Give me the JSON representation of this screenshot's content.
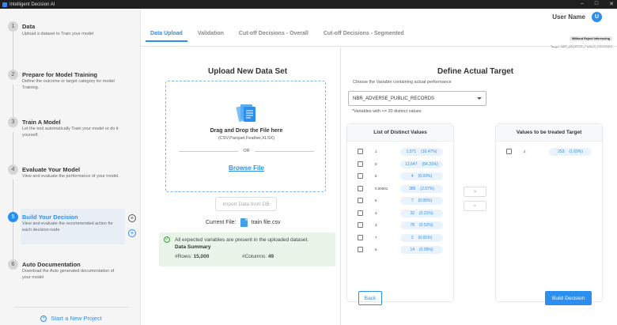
{
  "window": {
    "title": "Intelligent Decision AI"
  },
  "header": {
    "user_name": "User Name",
    "avatar_letter": "U"
  },
  "badge": {
    "label": "Without Reject Inferencing",
    "target": "Target: NBR_ADVERSE_PUBLIC_RECORDS"
  },
  "tabs": [
    {
      "label": "Data Upload",
      "active": true
    },
    {
      "label": "Validation",
      "active": false
    },
    {
      "label": "Cut-off Decisions - Overall",
      "active": false
    },
    {
      "label": "Cut-off Decisions - Segmented",
      "active": false
    }
  ],
  "steps": [
    {
      "num": "1",
      "title": "Data",
      "desc": "Upload a dataset to Train your model"
    },
    {
      "num": "2",
      "title": "Prepare for Model Training",
      "desc": "Define the outcome or target category for model Training."
    },
    {
      "num": "3",
      "title": "Train A Model",
      "desc": "Let the tool automatically Train your model or do it yourself."
    },
    {
      "num": "4",
      "title": "Evaluate Your Model",
      "desc": "View and evaluate the performance of your model."
    },
    {
      "num": "5",
      "title": "Build Your Decision",
      "desc": "View and evaluate the recommended action for each decision node"
    },
    {
      "num": "6",
      "title": "Auto Documentation",
      "desc": "Download the Auto generated documentation of your model"
    }
  ],
  "sidebar": {
    "new_project": "Start a New Project"
  },
  "upload": {
    "title": "Upload New Data Set",
    "drag_text": "Drag and Drop the File here",
    "types": "(CSV,Parquet,Feather,XLSX)",
    "or": "OR",
    "browse": "Browse File",
    "import": "Import Data from DB",
    "current_label": "Current File:",
    "current_file": "train file.csv"
  },
  "summary": {
    "message": "All expected variables are present in the uploaded dataset.",
    "title": "Data Summary",
    "rows_label": "#Rows:",
    "rows": "15,000",
    "cols_label": "#Columns:",
    "cols": "49"
  },
  "target": {
    "title": "Define Actual Target",
    "select_label": "Choose the Variable containing actual performance",
    "select_value": "NBR_ADVERSE_PUBLIC_RECORDS",
    "hint": "*Variables with <= 20 distinct values",
    "distinct_title": "List of Distinct Values",
    "treated_title": "Values to be treated Target",
    "distinct": [
      {
        "value": "1",
        "count": "1,571",
        "pct": "(10.47%)"
      },
      {
        "value": "0",
        "count": "12,647",
        "pct": "(84.31%)"
      },
      {
        "value": "8",
        "count": "4",
        "pct": "(0.03%)"
      },
      {
        "value": "0.00001",
        "count": "386",
        "pct": "(2.57%)"
      },
      {
        "value": "6",
        "count": "7",
        "pct": "(0.05%)"
      },
      {
        "value": "4",
        "count": "32",
        "pct": "(0.21%)"
      },
      {
        "value": "3",
        "count": "78",
        "pct": "(0.52%)"
      },
      {
        "value": "7",
        "count": "2",
        "pct": "(0.01%)"
      },
      {
        "value": "5",
        "count": "14",
        "pct": "(0.09%)"
      }
    ],
    "treated": [
      {
        "value": "2",
        "count": "253",
        "pct": "(1.69%)"
      }
    ],
    "move_right": ">",
    "move_left": "<",
    "back": "Back",
    "build": "Build Decision"
  }
}
